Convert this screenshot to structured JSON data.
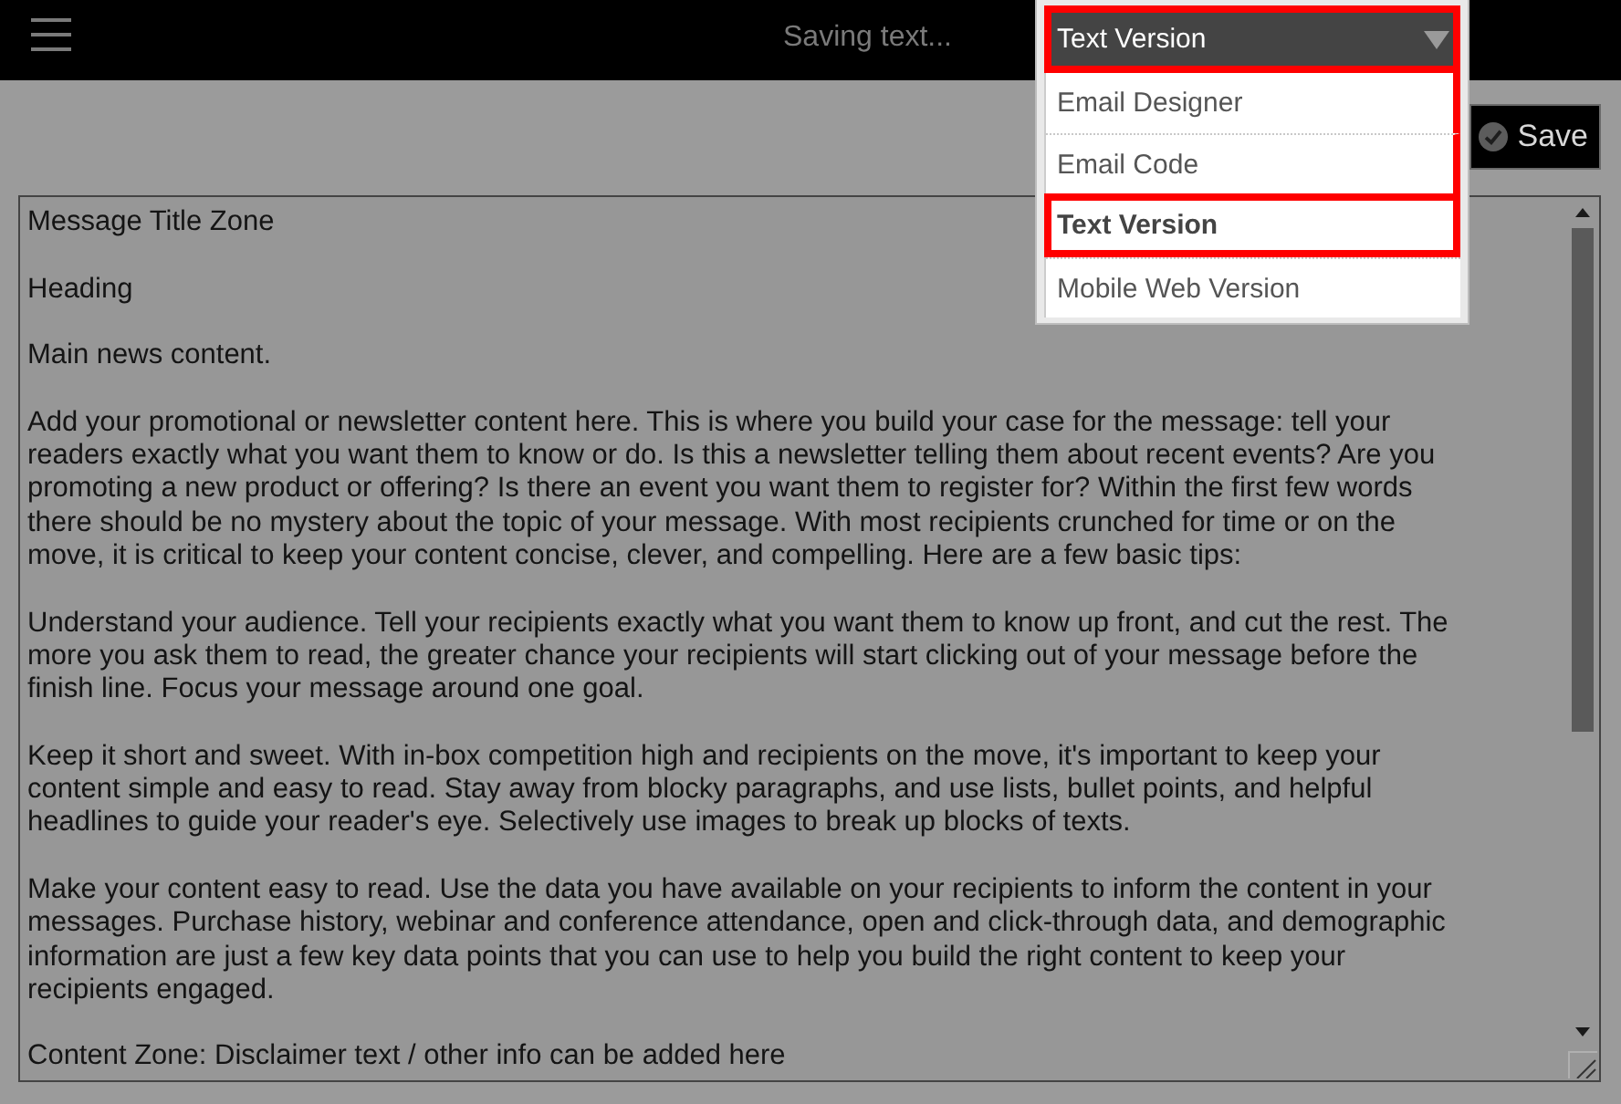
{
  "top_bar": {
    "status": "Saving text..."
  },
  "view_select": {
    "value": "Text Version",
    "highlighted": true,
    "expanded": true,
    "options": [
      {
        "label": "Email Designer",
        "selected": false,
        "highlighted": true
      },
      {
        "label": "Email Code",
        "selected": false,
        "highlighted": true
      },
      {
        "label": "Text Version",
        "selected": true,
        "highlighted": true
      },
      {
        "label": "Mobile Web Version",
        "selected": false,
        "highlighted": false
      }
    ]
  },
  "save_button": {
    "label": "Save"
  },
  "editor": {
    "paragraphs": [
      [
        "Message Title Zone"
      ],
      [
        "Heading"
      ],
      [
        "Main news content."
      ],
      [
        "Add your promotional or newsletter content here. This is where you build your case for the message: tell your",
        "readers exactly what you want them to know or do. Is this a newsletter telling them about recent events? Are you",
        "promoting a new product or offering? Is there an event you want them to register for? Within the first few words",
        "there should be no mystery about the topic of your message. With most recipients crunched for time or on the",
        "move, it is critical to keep your content concise, clever, and compelling. Here are a few basic tips:"
      ],
      [
        "Understand your audience. Tell your recipients exactly what you want them to know up front, and cut the rest. The",
        "more you ask them to read, the greater chance your recipients will start clicking out of your message before the",
        "finish line. Focus your message around one goal."
      ],
      [
        "Keep it short and sweet. With in-box competition high and recipients on the move, it's important to keep your",
        "content simple and easy to read. Stay away from blocky paragraphs, and use lists, bullet points, and helpful",
        "headlines to guide your reader's eye. Selectively use images to break up blocks of texts."
      ],
      [
        "Make your content easy to read. Use the data you have available on your recipients to inform the content in your",
        "messages. Purchase history, webinar and conference attendance, open and click-through data, and demographic",
        "information are just a few key data points that you can use to help you build the right content to keep your",
        "recipients engaged."
      ],
      [
        "Content Zone: Disclaimer text / other info can be added here"
      ]
    ]
  }
}
